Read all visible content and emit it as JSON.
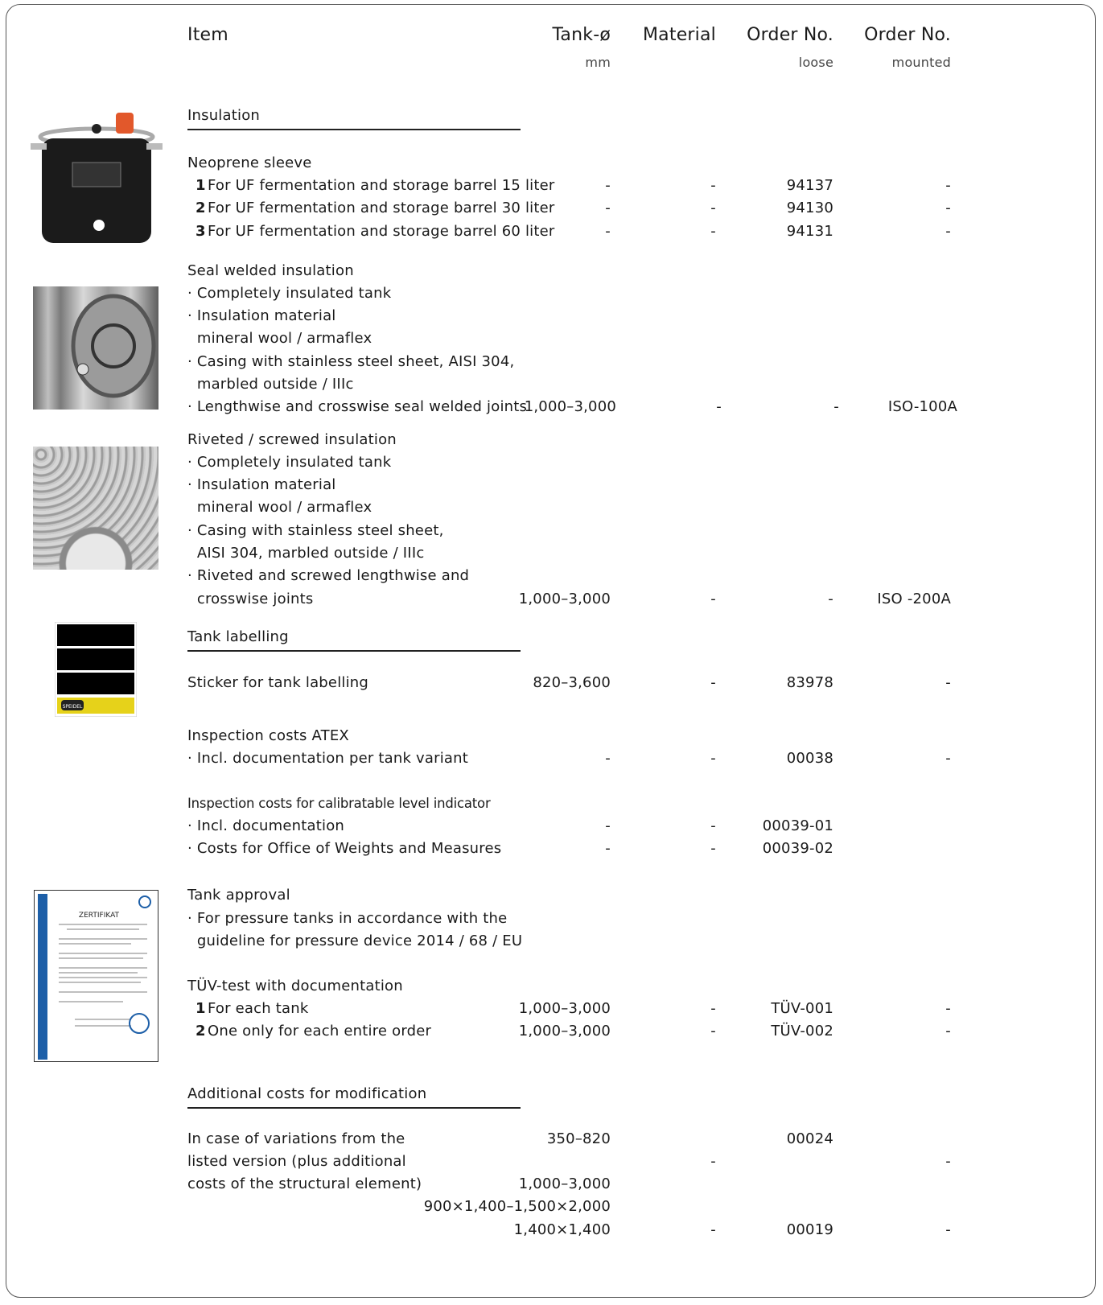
{
  "header": {
    "item": "Item",
    "tank": "Tank-ø",
    "tank_unit": "mm",
    "material": "Material",
    "order_loose": "Order No.",
    "order_loose_sub": "loose",
    "order_mounted": "Order No.",
    "order_mounted_sub": "mounted"
  },
  "insulation": {
    "section": "Insulation",
    "neoprene": {
      "title": "Neoprene sleeve",
      "rows": [
        {
          "num": "1",
          "label": "For UF fermentation and storage barrel 15 liter",
          "tank": "-",
          "material": "-",
          "loose": "94137",
          "mounted": "-"
        },
        {
          "num": "2",
          "label": "For UF fermentation and storage barrel 30 liter",
          "tank": "-",
          "material": "-",
          "loose": "94130",
          "mounted": "-"
        },
        {
          "num": "3",
          "label": "For UF fermentation and storage barrel 60 liter",
          "tank": "-",
          "material": "-",
          "loose": "94131",
          "mounted": "-"
        }
      ]
    },
    "seal": {
      "title": "Seal welded insulation",
      "lines": [
        "· Completely insulated tank",
        "· Insulation material",
        "  mineral wool / armaflex",
        "· Casing with stainless steel sheet, AISI 304,",
        "  marbled outside / IIIc",
        "· Lengthwise and crosswise seal welded joints"
      ],
      "tank": "1,000–3,000",
      "material": "-",
      "loose": "-",
      "mounted": "ISO-100A"
    },
    "riveted": {
      "title": "Riveted / screwed insulation",
      "lines": [
        "· Completely insulated tank",
        "· Insulation material",
        "  mineral wool / armaflex",
        "· Casing with stainless steel sheet,",
        "  AISI 304, marbled outside / IIIc",
        "· Riveted and screwed lengthwise and",
        "  crosswise joints"
      ],
      "tank": "1,000–3,000",
      "material": "-",
      "loose": "-",
      "mounted": "ISO -200A"
    }
  },
  "labelling": {
    "section": "Tank labelling",
    "sticker": {
      "label": "Sticker for tank labelling",
      "tank": "820–3,600",
      "material": "-",
      "loose": "83978",
      "mounted": "-"
    },
    "sticker_brand": "SPEIDEL",
    "atex": {
      "title": "Inspection costs ATEX",
      "line": "· Incl. documentation per tank variant",
      "tank": "-",
      "material": "-",
      "loose": "00038",
      "mounted": "-"
    },
    "calib": {
      "title": "Inspection costs for calibratable level indicator",
      "rows": [
        {
          "label": "· Incl. documentation",
          "tank": "-",
          "material": "-",
          "loose": "00039-01"
        },
        {
          "label": "· Costs for Office of Weights and Measures",
          "tank": "-",
          "material": "-",
          "loose": "00039-02"
        }
      ]
    }
  },
  "approval": {
    "title": "Tank approval",
    "lines": [
      "· For pressure tanks in accordance with the",
      "  guideline for pressure device 2014 / 68 / EU"
    ],
    "cert_title": "ZERTIFIKAT",
    "tuv": {
      "title": "TÜV-test with documentation",
      "rows": [
        {
          "num": "1",
          "label": "For each tank",
          "tank": "1,000–3,000",
          "material": "-",
          "loose": "TÜV-001",
          "mounted": "-"
        },
        {
          "num": "2",
          "label": "One only for each entire order",
          "tank": "1,000–3,000",
          "material": "-",
          "loose": "TÜV-002",
          "mounted": "-"
        }
      ]
    }
  },
  "modification": {
    "section": "Additional costs for modification",
    "lines": [
      "In case of variations from the",
      "listed version (plus additional",
      "costs of the structural element)"
    ],
    "tank_values": [
      "350–820",
      "1,000–3,000",
      "900×1,400–1,500×2,000",
      "1,400×1,400"
    ],
    "material_values": [
      "-",
      "-"
    ],
    "loose_values": [
      "00024",
      "00019"
    ],
    "mounted_values": [
      "-",
      "-"
    ]
  }
}
